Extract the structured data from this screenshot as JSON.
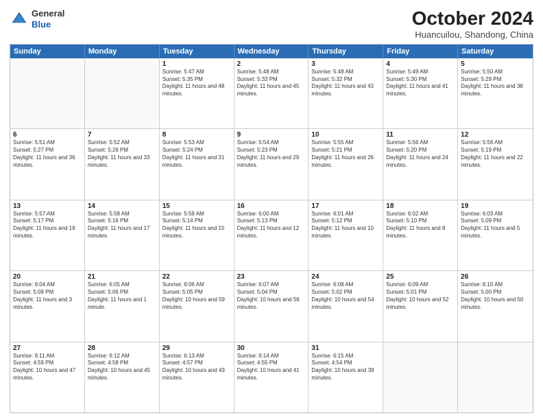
{
  "logo": {
    "general": "General",
    "blue": "Blue"
  },
  "title": "October 2024",
  "subtitle": "Huancuilou, Shandong, China",
  "headers": [
    "Sunday",
    "Monday",
    "Tuesday",
    "Wednesday",
    "Thursday",
    "Friday",
    "Saturday"
  ],
  "weeks": [
    [
      {
        "day": "",
        "info": ""
      },
      {
        "day": "",
        "info": ""
      },
      {
        "day": "1",
        "info": "Sunrise: 5:47 AM\nSunset: 5:35 PM\nDaylight: 11 hours and 48 minutes."
      },
      {
        "day": "2",
        "info": "Sunrise: 5:48 AM\nSunset: 5:33 PM\nDaylight: 11 hours and 45 minutes."
      },
      {
        "day": "3",
        "info": "Sunrise: 5:48 AM\nSunset: 5:32 PM\nDaylight: 11 hours and 43 minutes."
      },
      {
        "day": "4",
        "info": "Sunrise: 5:49 AM\nSunset: 5:30 PM\nDaylight: 11 hours and 41 minutes."
      },
      {
        "day": "5",
        "info": "Sunrise: 5:50 AM\nSunset: 5:29 PM\nDaylight: 11 hours and 38 minutes."
      }
    ],
    [
      {
        "day": "6",
        "info": "Sunrise: 5:51 AM\nSunset: 5:27 PM\nDaylight: 11 hours and 36 minutes."
      },
      {
        "day": "7",
        "info": "Sunrise: 5:52 AM\nSunset: 5:26 PM\nDaylight: 11 hours and 33 minutes."
      },
      {
        "day": "8",
        "info": "Sunrise: 5:53 AM\nSunset: 5:24 PM\nDaylight: 11 hours and 31 minutes."
      },
      {
        "day": "9",
        "info": "Sunrise: 5:54 AM\nSunset: 5:23 PM\nDaylight: 11 hours and 29 minutes."
      },
      {
        "day": "10",
        "info": "Sunrise: 5:55 AM\nSunset: 5:21 PM\nDaylight: 11 hours and 26 minutes."
      },
      {
        "day": "11",
        "info": "Sunrise: 5:56 AM\nSunset: 5:20 PM\nDaylight: 11 hours and 24 minutes."
      },
      {
        "day": "12",
        "info": "Sunrise: 5:56 AM\nSunset: 5:19 PM\nDaylight: 11 hours and 22 minutes."
      }
    ],
    [
      {
        "day": "13",
        "info": "Sunrise: 5:57 AM\nSunset: 5:17 PM\nDaylight: 11 hours and 19 minutes."
      },
      {
        "day": "14",
        "info": "Sunrise: 5:58 AM\nSunset: 5:16 PM\nDaylight: 11 hours and 17 minutes."
      },
      {
        "day": "15",
        "info": "Sunrise: 5:59 AM\nSunset: 5:14 PM\nDaylight: 11 hours and 15 minutes."
      },
      {
        "day": "16",
        "info": "Sunrise: 6:00 AM\nSunset: 5:13 PM\nDaylight: 11 hours and 12 minutes."
      },
      {
        "day": "17",
        "info": "Sunrise: 6:01 AM\nSunset: 5:12 PM\nDaylight: 11 hours and 10 minutes."
      },
      {
        "day": "18",
        "info": "Sunrise: 6:02 AM\nSunset: 5:10 PM\nDaylight: 11 hours and 8 minutes."
      },
      {
        "day": "19",
        "info": "Sunrise: 6:03 AM\nSunset: 5:09 PM\nDaylight: 11 hours and 5 minutes."
      }
    ],
    [
      {
        "day": "20",
        "info": "Sunrise: 6:04 AM\nSunset: 5:08 PM\nDaylight: 11 hours and 3 minutes."
      },
      {
        "day": "21",
        "info": "Sunrise: 6:05 AM\nSunset: 5:06 PM\nDaylight: 11 hours and 1 minute."
      },
      {
        "day": "22",
        "info": "Sunrise: 6:06 AM\nSunset: 5:05 PM\nDaylight: 10 hours and 59 minutes."
      },
      {
        "day": "23",
        "info": "Sunrise: 6:07 AM\nSunset: 5:04 PM\nDaylight: 10 hours and 56 minutes."
      },
      {
        "day": "24",
        "info": "Sunrise: 6:08 AM\nSunset: 5:02 PM\nDaylight: 10 hours and 54 minutes."
      },
      {
        "day": "25",
        "info": "Sunrise: 6:09 AM\nSunset: 5:01 PM\nDaylight: 10 hours and 52 minutes."
      },
      {
        "day": "26",
        "info": "Sunrise: 6:10 AM\nSunset: 5:00 PM\nDaylight: 10 hours and 50 minutes."
      }
    ],
    [
      {
        "day": "27",
        "info": "Sunrise: 6:11 AM\nSunset: 4:59 PM\nDaylight: 10 hours and 47 minutes."
      },
      {
        "day": "28",
        "info": "Sunrise: 6:12 AM\nSunset: 4:58 PM\nDaylight: 10 hours and 45 minutes."
      },
      {
        "day": "29",
        "info": "Sunrise: 6:13 AM\nSunset: 4:57 PM\nDaylight: 10 hours and 43 minutes."
      },
      {
        "day": "30",
        "info": "Sunrise: 6:14 AM\nSunset: 4:55 PM\nDaylight: 10 hours and 41 minutes."
      },
      {
        "day": "31",
        "info": "Sunrise: 6:15 AM\nSunset: 4:54 PM\nDaylight: 10 hours and 39 minutes."
      },
      {
        "day": "",
        "info": ""
      },
      {
        "day": "",
        "info": ""
      }
    ]
  ]
}
